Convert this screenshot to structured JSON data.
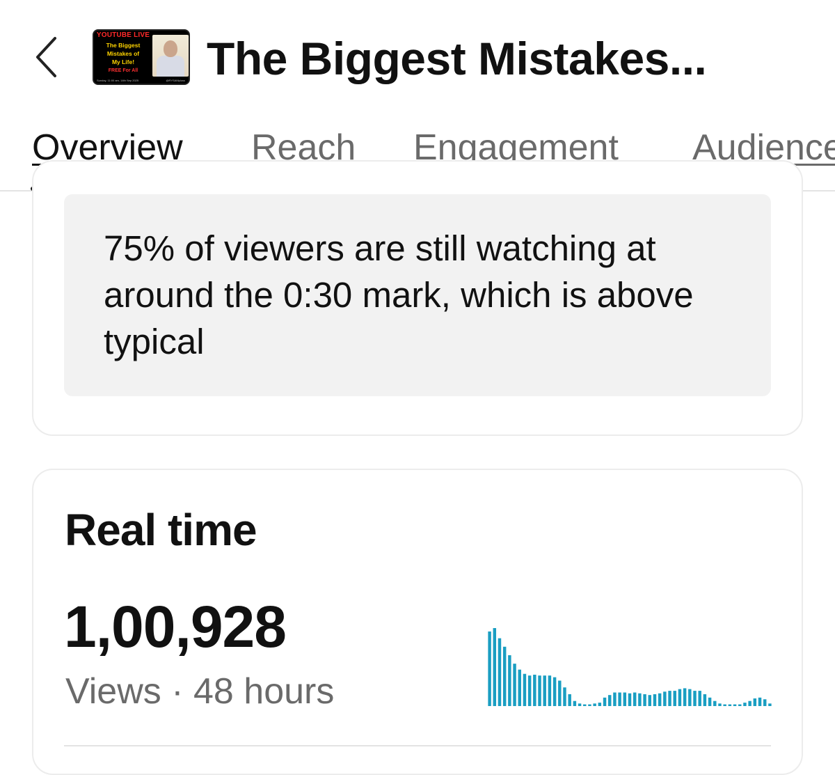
{
  "header": {
    "back_icon": "chevron-left-icon",
    "title": "The Biggest Mistakes...",
    "thumbnail": {
      "live_label": "YOUTUBE LIVE",
      "title_lines": [
        "The Biggest",
        "Mistakes of",
        "My Life!"
      ],
      "free_label": "FREE For All",
      "date_text": "Sunday, 11:00 am, 14th Sep 2025",
      "handle_text": "@RYSAMpluss"
    }
  },
  "tabs": [
    {
      "label": "Overview",
      "active": true
    },
    {
      "label": "Reach",
      "active": false
    },
    {
      "label": "Engagement",
      "active": false
    },
    {
      "label": "Audience",
      "active": false
    }
  ],
  "retention_card": {
    "message": "75% of viewers are still watching at around the 0:30 mark, which is above typical"
  },
  "realtime_card": {
    "title": "Real time",
    "views": "1,00,928",
    "subtitle": "Views · 48 hours",
    "bar_color": "#1a9ec2"
  },
  "chart_data": {
    "type": "bar",
    "series": [
      {
        "values": [
          88,
          92,
          80,
          70,
          60,
          50,
          43,
          38,
          36,
          37,
          36,
          36,
          36,
          34,
          30,
          22,
          14,
          6,
          3,
          2,
          2,
          3,
          4,
          10,
          13,
          16,
          16,
          16,
          15,
          16,
          15,
          14,
          13,
          14,
          15,
          17,
          18,
          18,
          20,
          21,
          20,
          18,
          18,
          14,
          10,
          6,
          3,
          2,
          2,
          2,
          2,
          4,
          6,
          9,
          10,
          8,
          3
        ]
      }
    ]
  }
}
